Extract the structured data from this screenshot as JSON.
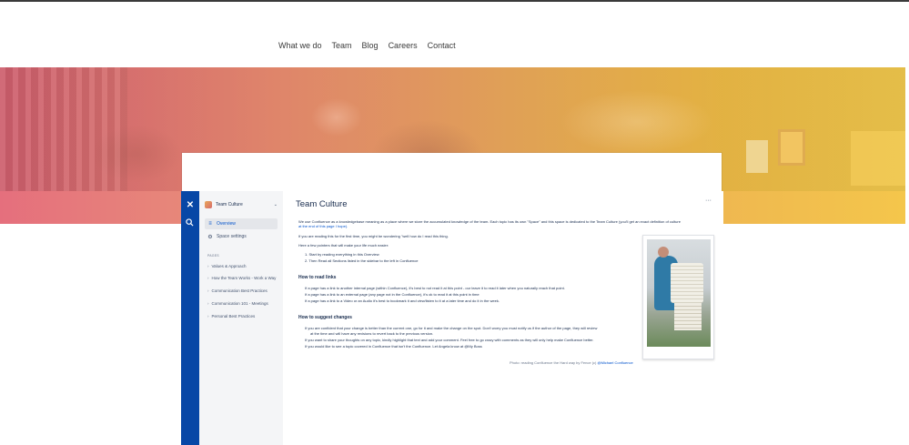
{
  "nav": {
    "items": [
      "What we do",
      "Team",
      "Blog",
      "Careers",
      "Contact"
    ]
  },
  "colors": {
    "rail": "#0747a6",
    "accent_link": "#0052cc",
    "hero_left": "#e56f7d",
    "hero_right": "#f3c84a"
  },
  "app": {
    "rail_icons": [
      "confluence-logo-icon",
      "search-icon"
    ],
    "space_name": "Team Culture",
    "sidebar": {
      "overview": "Overview",
      "space_settings": "Space settings",
      "pages_label": "PAGES",
      "tree": [
        "Values & Approach",
        "How the Team Works - Work a Way",
        "Communication Best Practices",
        "Communication 101 - Meetings",
        "Personal Best Practices"
      ]
    },
    "page": {
      "title": "Team Culture",
      "intro_1": "We use Confluence as a knowledgebase meaning as a place where we store the accumulated knowledge of the team. Each topic has its own \"Space\" and this space is dedicated to the Team Culture (you'll get an exact definition of culture",
      "intro_1b": "at the end of this page I hope).",
      "intro_2": "If you are reading this for the first time, you might be wondering \"well how do I read this thing.",
      "intro_3": "Here a few pointers that will make your life much easier:",
      "steps": [
        "1.  Start by reading everything in this Overview",
        "2.  Then Read all Sections listed in the sidebar to the left in Confluence"
      ],
      "h_links": "How to read links",
      "links_bullets": [
        "If a page has a link to another internal page (within Confluence), it's best to not read it at this point - our leave it to read it later when you naturally reach that point.",
        "If a page has a link to an external page (any page not in the Confluence), it's ok to read it at this point in time",
        "If a page has a link to a Video or an Audio it's best to bookmark it and view/listen to it at a later time and do it in the week."
      ],
      "h_changes": "How to suggest changes",
      "changes_bullets": [
        "If you are confident that your change is better than the current one, go for it and make the change on the spot. Don't worry you must notify us if the author of the page, they will review",
        "at the time and will have any revisions to revert back to the previous version.",
        "If you want to share your thoughts on any topic, kindly highlight that text and add your comment. Feel free to go crazy with comments as they will only help make Confluence better.",
        "If you would like to see a topic covered in Confluence that isn't the Confluence. Let Angela know at @My Boss"
      ],
      "attribution_prefix": "Photo: reading Confluence the Hard way by Fence (c)",
      "attribution_link": "@Michael Confluence"
    }
  }
}
